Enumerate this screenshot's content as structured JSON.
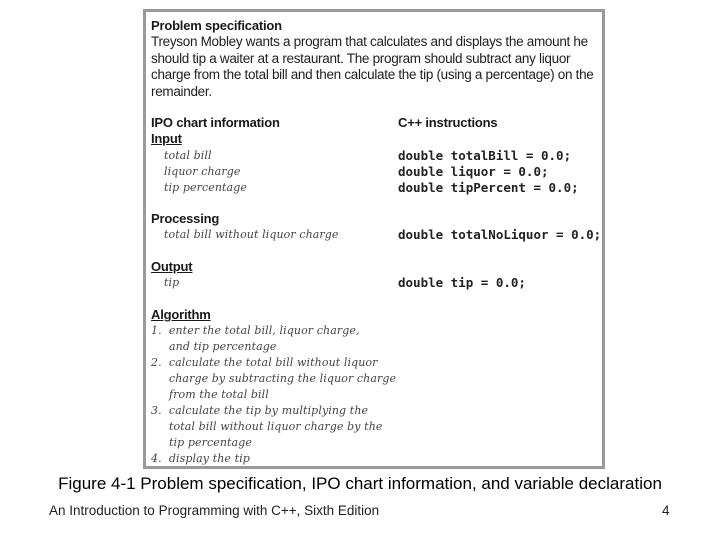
{
  "figure": {
    "problem_spec": {
      "heading": "Problem specification",
      "lines": [
        "Treyson Mobley wants a program that calculates and displays the amount he",
        "should tip a waiter at a restaurant. The program should subtract any liquor",
        "charge from the total bill and then calculate the tip (using a percentage) on the",
        "remainder."
      ]
    },
    "ipo_heading": "IPO chart information",
    "cpp_heading": "C++ instructions",
    "input": {
      "heading": "Input",
      "items": [
        "total bill",
        "liquor charge",
        "tip percentage"
      ],
      "code": [
        "double totalBill = 0.0;",
        "double liquor = 0.0;",
        "double tipPercent = 0.0;"
      ]
    },
    "processing": {
      "heading": "Processing",
      "items": [
        "total bill without liquor charge"
      ],
      "code": [
        "double totalNoLiquor = 0.0;"
      ]
    },
    "output": {
      "heading": "Output",
      "items": [
        "tip"
      ],
      "code": [
        "double tip = 0.0;"
      ]
    },
    "algorithm": {
      "heading": "Algorithm",
      "lines": [
        "1.  enter the total bill, liquor charge,",
        "     and tip percentage",
        "2.  calculate the total bill without liquor",
        "     charge by subtracting the liquor charge",
        "     from the total bill",
        "3.  calculate the tip by multiplying the",
        "     total bill without liquor charge by the",
        "     tip percentage",
        "4.  display the tip"
      ]
    }
  },
  "caption": "Figure 4-1 Problem specification, IPO chart information, and variable declaration",
  "footer": {
    "book_title": "An Introduction to Programming with C++, Sixth Edition",
    "page_number": "4"
  }
}
